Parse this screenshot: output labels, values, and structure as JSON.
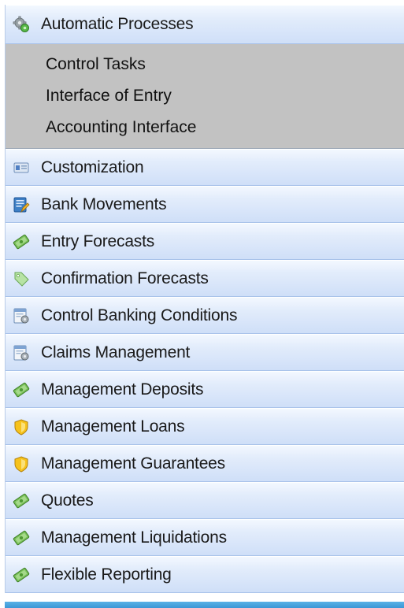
{
  "menu": {
    "header": {
      "label": "Automatic Processes",
      "icon": "gears-icon"
    },
    "submenu": [
      {
        "label": "Control Tasks"
      },
      {
        "label": "Interface of Entry"
      },
      {
        "label": "Accounting Interface"
      }
    ],
    "items": [
      {
        "label": "Customization",
        "icon": "id-card-icon"
      },
      {
        "label": "Bank Movements",
        "icon": "document-edit-icon"
      },
      {
        "label": "Entry Forecasts",
        "icon": "money-icon"
      },
      {
        "label": "Confirmation Forecasts",
        "icon": "tag-icon"
      },
      {
        "label": "Control Banking Conditions",
        "icon": "document-gear-icon"
      },
      {
        "label": "Claims Management",
        "icon": "document-gear-icon"
      },
      {
        "label": "Management Deposits",
        "icon": "money-icon"
      },
      {
        "label": "Management Loans",
        "icon": "shield-icon"
      },
      {
        "label": "Management Guarantees",
        "icon": "shield-icon"
      },
      {
        "label": "Quotes",
        "icon": "money-icon"
      },
      {
        "label": "Management Liquidations",
        "icon": "money-icon"
      },
      {
        "label": "Flexible Reporting",
        "icon": "money-icon"
      }
    ]
  },
  "colors": {
    "item_gradient_top": "#f3f8ff",
    "item_gradient_bottom": "#cfdff8",
    "submenu_background": "#c2c2c2",
    "bottom_bar": "#4aa5df"
  }
}
